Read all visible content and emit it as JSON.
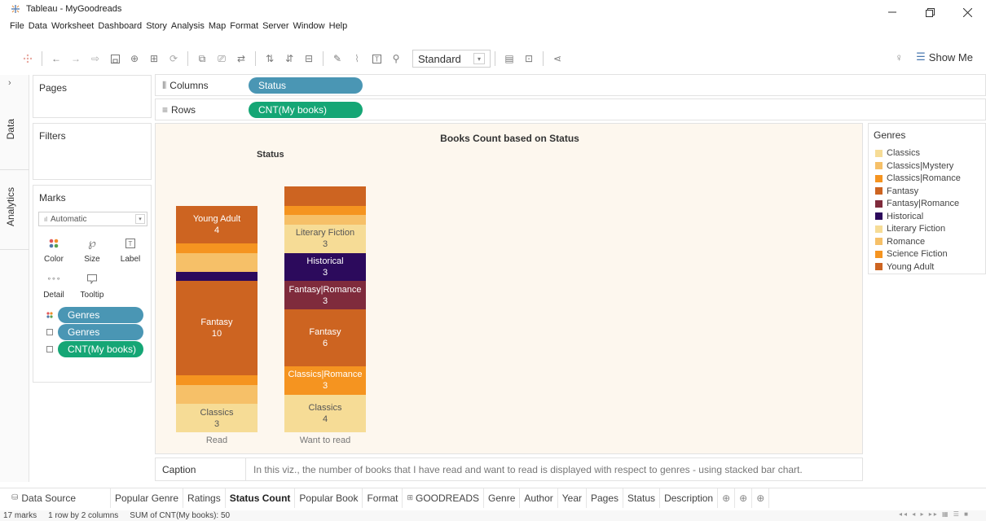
{
  "window": {
    "title": "Tableau - MyGoodreads"
  },
  "menu": [
    "File",
    "Data",
    "Worksheet",
    "Dashboard",
    "Story",
    "Analysis",
    "Map",
    "Format",
    "Server",
    "Window",
    "Help"
  ],
  "toolbar": {
    "fit_select": "Standard",
    "show_me": "Show Me"
  },
  "side": {
    "data_tab": "Data",
    "analytics_tab": "Analytics"
  },
  "pages_card": {
    "title": "Pages"
  },
  "filters_card": {
    "title": "Filters"
  },
  "marks_card": {
    "title": "Marks",
    "mark_type": "Automatic",
    "buttons": {
      "color": "Color",
      "size": "Size",
      "label": "Label",
      "detail": "Detail",
      "tooltip": "Tooltip"
    },
    "fields": [
      {
        "name": "Genres",
        "kind": "color"
      },
      {
        "name": "Genres",
        "kind": "label"
      },
      {
        "name": "CNT(My books)",
        "kind": "label"
      }
    ]
  },
  "shelves": {
    "columns_label": "Columns",
    "columns_pill": "Status",
    "rows_label": "Rows",
    "rows_pill": "CNT(My books)"
  },
  "viz": {
    "title": "Books Count based on Status",
    "header": "Status"
  },
  "chart_data": {
    "type": "bar",
    "stacked": true,
    "title": "Books Count based on Status",
    "column_header": "Status",
    "categories": [
      "Read",
      "Want to read"
    ],
    "series": [
      {
        "name": "Classics",
        "values": [
          3,
          4
        ],
        "color": "#f6dc96"
      },
      {
        "name": "Classics|Mystery",
        "values": [
          2,
          0
        ],
        "color": "#f6c068"
      },
      {
        "name": "Classics|Romance",
        "values": [
          1,
          3
        ],
        "color": "#f59420"
      },
      {
        "name": "Fantasy",
        "values": [
          10,
          6
        ],
        "color": "#cd6421"
      },
      {
        "name": "Fantasy|Romance",
        "values": [
          0,
          3
        ],
        "color": "#7f2b3c"
      },
      {
        "name": "Historical",
        "values": [
          1,
          3
        ],
        "color": "#2c0a5c"
      },
      {
        "name": "Literary Fiction",
        "values": [
          0,
          3
        ],
        "color": "#f6dc96"
      },
      {
        "name": "Romance",
        "values": [
          2,
          1
        ],
        "color": "#f6c068"
      },
      {
        "name": "Science Fiction",
        "values": [
          1,
          1
        ],
        "color": "#f59420"
      },
      {
        "name": "Young Adult",
        "values": [
          4,
          2
        ],
        "color": "#cd6421"
      }
    ],
    "ylim": [
      0,
      25
    ],
    "grid": false,
    "legend": "right"
  },
  "legend": {
    "title": "Genres",
    "items": [
      {
        "label": "Classics",
        "color": "#f6dc96"
      },
      {
        "label": "Classics|Mystery",
        "color": "#f6c068"
      },
      {
        "label": "Classics|Romance",
        "color": "#f59420"
      },
      {
        "label": "Fantasy",
        "color": "#cd6421"
      },
      {
        "label": "Fantasy|Romance",
        "color": "#7f2b3c"
      },
      {
        "label": "Historical",
        "color": "#2c0a5c"
      },
      {
        "label": "Literary Fiction",
        "color": "#f6dc96"
      },
      {
        "label": "Romance",
        "color": "#f6c068"
      },
      {
        "label": "Science Fiction",
        "color": "#f59420"
      },
      {
        "label": "Young Adult",
        "color": "#cd6421"
      }
    ]
  },
  "caption": {
    "label": "Caption",
    "text": "In this viz., the number of books that I have read and want to read is displayed with respect to genres - using stacked bar chart."
  },
  "sheet_tabs": {
    "data_source": "Data Source",
    "tabs": [
      "Popular Genre",
      "Ratings",
      "Status Count",
      "Popular Book",
      "Format",
      "GOODREADS",
      "Genre",
      "Author",
      "Year",
      "Pages",
      "Status",
      "Description"
    ],
    "active": "Status Count"
  },
  "status": {
    "marks": "17 marks",
    "layout": "1 row by 2 columns",
    "sum": "SUM of CNT(My books): 50"
  }
}
